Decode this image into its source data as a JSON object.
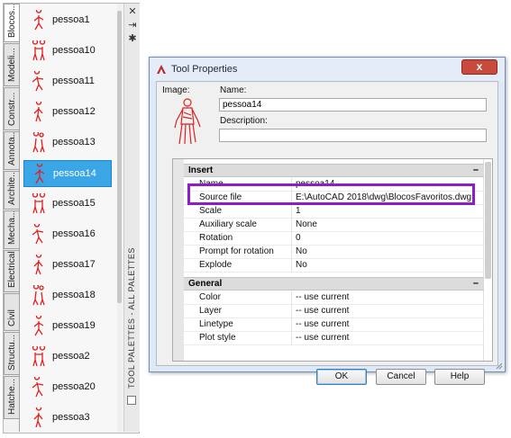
{
  "palette": {
    "title": "TOOL PALETTES - ALL PALETTES",
    "tabs": [
      "Blocos...",
      "Modeli...",
      "Constr...",
      "Annota...",
      "Archite...",
      "Mecha...",
      "Electrical",
      "Civil",
      "Structu...",
      "Hatche..."
    ],
    "active_tab_index": 0,
    "items": [
      "pessoa1",
      "pessoa10",
      "pessoa11",
      "pessoa12",
      "pessoa13",
      "pessoa14",
      "pessoa15",
      "pessoa16",
      "pessoa17",
      "pessoa18",
      "pessoa19",
      "pessoa2",
      "pessoa20",
      "pessoa3"
    ],
    "selected_item_index": 5,
    "icons": {
      "close": "close-icon",
      "autohide": "autohide-icon",
      "properties": "properties-icon"
    },
    "accent_color": "#3aa6e6"
  },
  "dialog": {
    "title": "Tool Properties",
    "close_label": "x",
    "image_label": "Image:",
    "name_label": "Name:",
    "name_value": "pessoa14",
    "description_label": "Description:",
    "description_value": "",
    "sections": [
      {
        "title": "Insert",
        "collapse": "–",
        "rows": [
          {
            "name": "Name",
            "value": "pessoa14"
          },
          {
            "name": "Source file",
            "value": "E:\\AutoCAD 2018\\dwg\\BlocosFavoritos.dwg"
          },
          {
            "name": "Scale",
            "value": "1"
          },
          {
            "name": "Auxiliary scale",
            "value": "None"
          },
          {
            "name": "Rotation",
            "value": "0"
          },
          {
            "name": "Prompt for rotation",
            "value": "No"
          },
          {
            "name": "Explode",
            "value": "No"
          }
        ]
      },
      {
        "title": "General",
        "collapse": "–",
        "rows": [
          {
            "name": "Color",
            "value": "-- use current"
          },
          {
            "name": "Layer",
            "value": "-- use current"
          },
          {
            "name": "Linetype",
            "value": "-- use current"
          },
          {
            "name": "Plot style",
            "value": "-- use current"
          }
        ]
      }
    ],
    "buttons": {
      "ok": "OK",
      "cancel": "Cancel",
      "help": "Help"
    },
    "highlight_color": "#8b1ec9",
    "block_color": "#e02020"
  }
}
